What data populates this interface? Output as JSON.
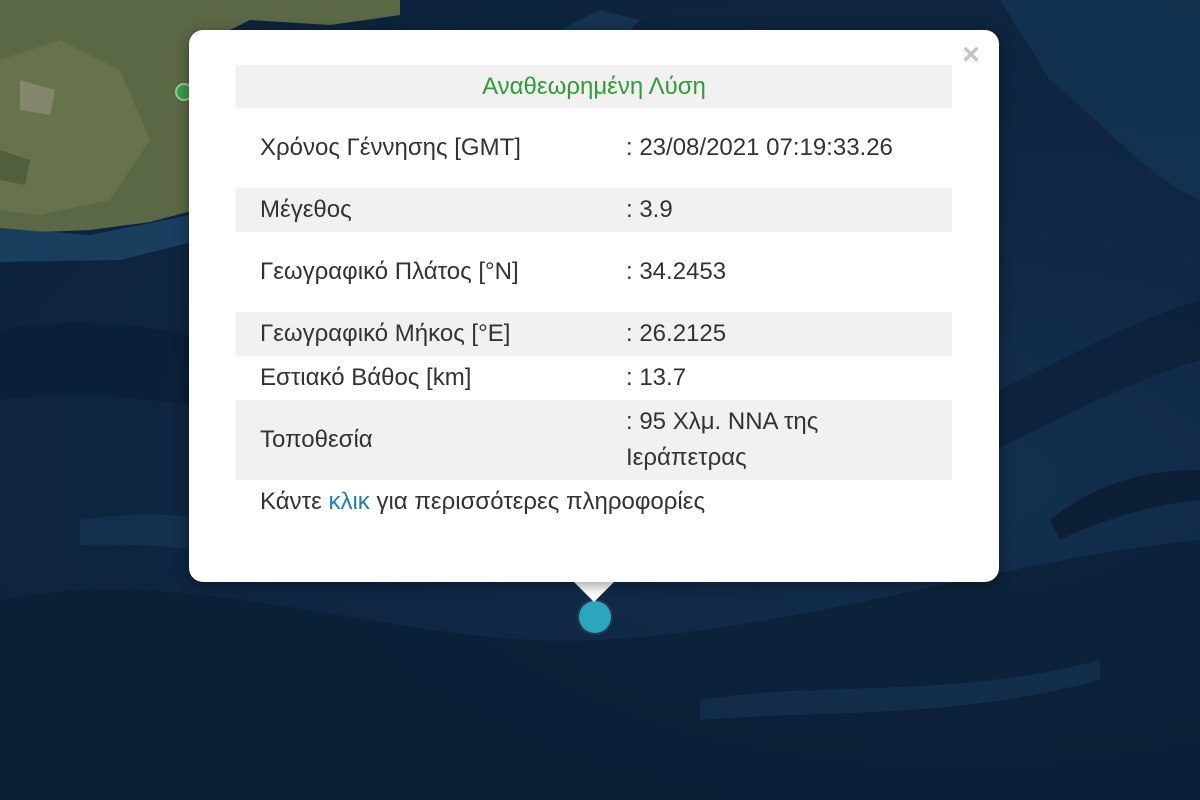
{
  "popup": {
    "header": "Αναθεωρημένη Λύση",
    "close_icon": "×",
    "rows": [
      {
        "label": "Χρόνος Γέννησης [GMT]",
        "value": ": 23/08/2021 07:19:33.26"
      },
      {
        "label": "Μέγεθος",
        "value": ": 3.9"
      },
      {
        "label": "Γεωγραφικό Πλάτος [°N]",
        "value": ": 34.2453"
      },
      {
        "label": "Γεωγραφικό Μήκος [°E]",
        "value": ": 26.2125"
      },
      {
        "label": "Εστιακό Βάθος [km]",
        "value": ": 13.7"
      },
      {
        "label": "Τοποθεσία",
        "value": ": 95 Χλμ. ΝΝΑ της Ιεράπετρας"
      }
    ],
    "footer": {
      "prefix": "Κάντε ",
      "link": "κλικ",
      "suffix": " για περισσότερες πληροφορίες"
    }
  },
  "colors": {
    "sea": "#0f2743",
    "land": "#5e6a46",
    "marker": "#2ba6bd",
    "header_text": "#2f9e34",
    "link": "#1e7fb8"
  },
  "icons": {
    "close": "close-icon",
    "epicenter": "epicenter-marker",
    "station": "green-marker"
  }
}
